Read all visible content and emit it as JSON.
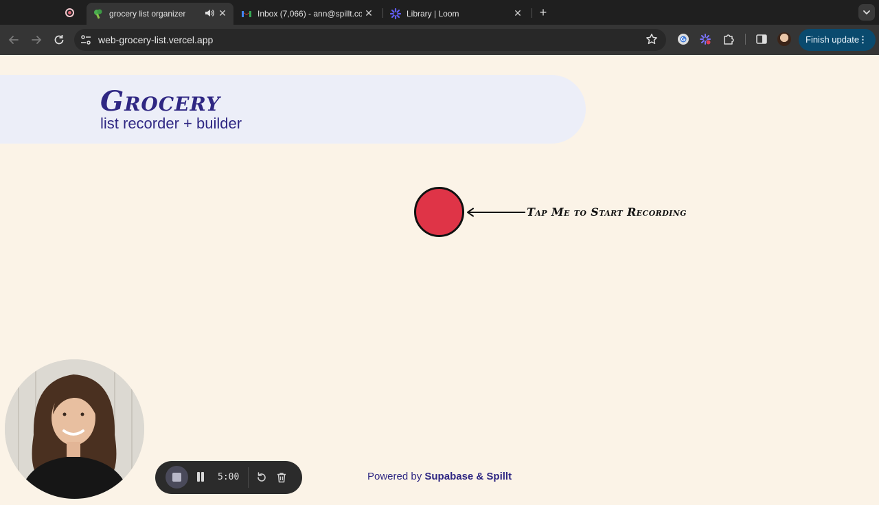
{
  "browser": {
    "tabs": [
      {
        "title": "grocery list organizer",
        "active": true,
        "favicon": "broccoli-icon",
        "audio": true
      },
      {
        "title": "Inbox (7,066) - ann@spillt.co",
        "active": false,
        "favicon": "gmail-icon"
      },
      {
        "title": "Library | Loom",
        "active": false,
        "favicon": "loom-icon"
      }
    ],
    "url": "web-grocery-list.vercel.app",
    "finish_update_label": "Finish update"
  },
  "page": {
    "brand_title": "Grocery",
    "brand_subtitle": "list recorder + builder",
    "record_hint": "Tap Me to Start Recording",
    "footer_prefix": "Powered by",
    "footer_brand": "Supabase & Spillt"
  },
  "loom": {
    "timer": "5:00"
  },
  "colors": {
    "page_bg": "#fbf3e7",
    "hero_band": "#eceef8",
    "brand": "#2f2783",
    "record": "#df3447",
    "update_button": "#0a4a6e"
  }
}
